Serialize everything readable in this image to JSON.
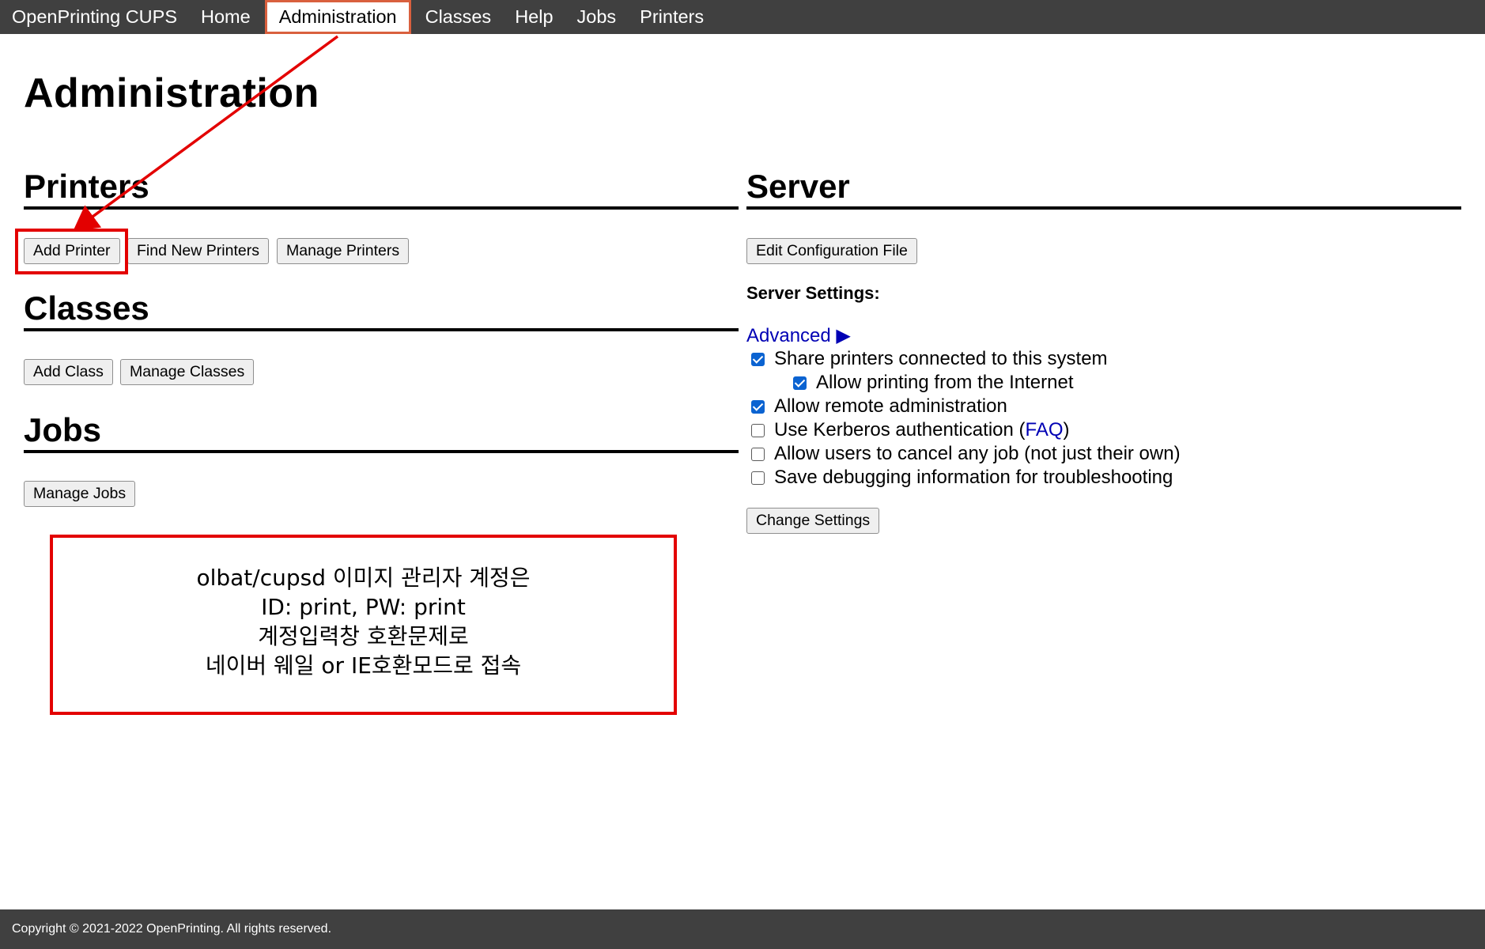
{
  "nav": {
    "brand": "OpenPrinting CUPS",
    "items": [
      "Home",
      "Administration",
      "Classes",
      "Help",
      "Jobs",
      "Printers"
    ],
    "active": "Administration"
  },
  "page_title": "Administration",
  "printers": {
    "heading": "Printers",
    "buttons": [
      "Add Printer",
      "Find New Printers",
      "Manage Printers"
    ]
  },
  "classes": {
    "heading": "Classes",
    "buttons": [
      "Add Class",
      "Manage Classes"
    ]
  },
  "jobs": {
    "heading": "Jobs",
    "buttons": [
      "Manage Jobs"
    ]
  },
  "server": {
    "heading": "Server",
    "edit_config_button": "Edit Configuration File",
    "settings_label": "Server Settings:",
    "advanced_link": "Advanced ▶",
    "options": [
      {
        "label": "Share printers connected to this system",
        "checked": true
      },
      {
        "label": "Allow printing from the Internet",
        "checked": true
      },
      {
        "label": "Allow remote administration",
        "checked": true
      },
      {
        "label": "Use Kerberos authentication (",
        "link": "FAQ",
        "suffix": ")",
        "checked": false
      },
      {
        "label": "Allow users to cancel any job (not just their own)",
        "checked": false
      },
      {
        "label": "Save debugging information for troubleshooting",
        "checked": false
      }
    ],
    "change_settings_button": "Change Settings"
  },
  "annotation": {
    "lines": [
      "olbat/cupsd 이미지 관리자 계정은",
      "ID: print, PW: print",
      "계정입력창 호환문제로",
      "네이버 웨일 or IE호환모드로 접속"
    ],
    "color": "#e30000"
  },
  "footer": "Copyright © 2021-2022 OpenPrinting. All rights reserved."
}
